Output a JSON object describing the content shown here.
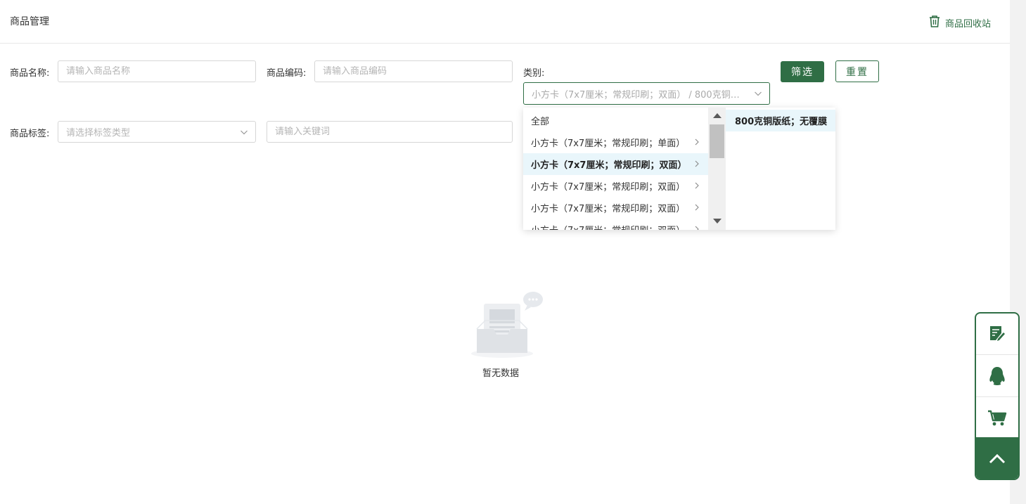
{
  "header": {
    "title": "商品管理",
    "recycle_label": "商品回收站"
  },
  "filters": {
    "name_label": "商品名称:",
    "name_placeholder": "请输入商品名称",
    "code_label": "商品编码:",
    "code_placeholder": "请输入商品编码",
    "category_label": "类别:",
    "category_value": "小方卡（7x7厘米；常规印刷；双面） / 800克铜…",
    "tag_label": "商品标签:",
    "tag_placeholder": "请选择标签类型",
    "keyword_placeholder": "请输入关键词",
    "filter_button": "筛选",
    "reset_button": "重置"
  },
  "cascader": {
    "level1": [
      {
        "label": "全部",
        "has_children": false,
        "active": false
      },
      {
        "label": "小方卡（7x7厘米；常规印刷；单面）",
        "has_children": true,
        "active": false
      },
      {
        "label": "小方卡（7x7厘米；常规印刷；双面）",
        "has_children": true,
        "active": true
      },
      {
        "label": "小方卡（7x7厘米；常规印刷；双面）",
        "has_children": true,
        "active": false
      },
      {
        "label": "小方卡（7x7厘米；常规印刷；双面）",
        "has_children": true,
        "active": false
      },
      {
        "label": "小方卡（7x7厘米；常规印刷；双面）",
        "has_children": true,
        "active": false
      }
    ],
    "level2": [
      {
        "label": "800克铜版纸；无覆膜",
        "active": true
      }
    ]
  },
  "empty_state": {
    "text": "暂无数据"
  },
  "float_bar": {
    "items": [
      "note-edit-icon",
      "qq-penguin-icon",
      "cart-icon",
      "chevron-up-icon"
    ]
  },
  "colors": {
    "brand": "#2f6e45",
    "active_row": "#e9f6fb"
  }
}
